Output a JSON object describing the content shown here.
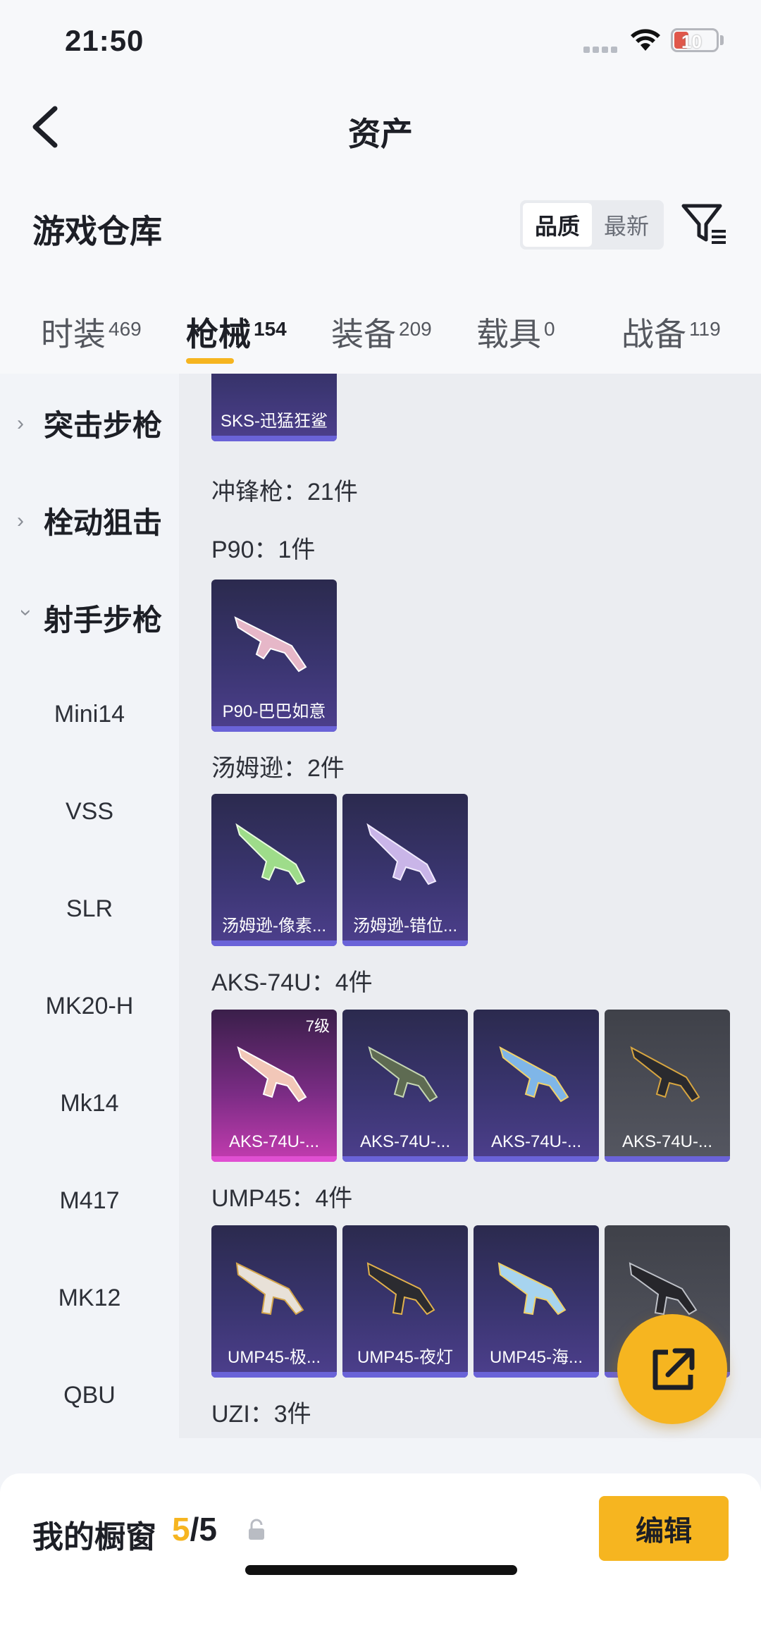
{
  "status_bar": {
    "time": "21:50",
    "battery": "10"
  },
  "header": {
    "title": "资产"
  },
  "warehouse": {
    "title": "游戏仓库",
    "sort_options": [
      {
        "label": "品质",
        "active": true
      },
      {
        "label": "最新",
        "active": false
      }
    ]
  },
  "tabs": [
    {
      "label": "时装",
      "count": "469",
      "active": false
    },
    {
      "label": "枪械",
      "count": "154",
      "active": true
    },
    {
      "label": "装备",
      "count": "209",
      "active": false
    },
    {
      "label": "载具",
      "count": "0",
      "active": false
    },
    {
      "label": "战备",
      "count": "119",
      "active": false
    }
  ],
  "sidebar": {
    "categories": [
      {
        "label": "突击步枪",
        "expanded": false
      },
      {
        "label": "栓动狙击",
        "expanded": false
      },
      {
        "label": "射手步枪",
        "expanded": true
      }
    ],
    "sub_items": [
      "Mini14",
      "VSS",
      "SLR",
      "MK20-H",
      "Mk14",
      "M417",
      "MK12",
      "QBU"
    ]
  },
  "content": {
    "top_card": "SKS-迅猛狂鲨",
    "groups": [
      {
        "label": "冲锋枪：21件"
      },
      {
        "label": "P90：1件",
        "cards": [
          {
            "name": "P90-巴巴如意",
            "style": "purple"
          }
        ]
      },
      {
        "label": "汤姆逊：2件",
        "cards": [
          {
            "name": "汤姆逊-像素...",
            "style": "purple"
          },
          {
            "name": "汤姆逊-错位...",
            "style": "purple"
          }
        ]
      },
      {
        "label": "AKS-74U：4件",
        "cards": [
          {
            "name": "AKS-74U-...",
            "style": "pink",
            "level": "7级"
          },
          {
            "name": "AKS-74U-...",
            "style": "purple"
          },
          {
            "name": "AKS-74U-...",
            "style": "purple"
          },
          {
            "name": "AKS-74U-...",
            "style": "gray"
          }
        ]
      },
      {
        "label": "UMP45：4件",
        "cards": [
          {
            "name": "UMP45-极...",
            "style": "purple"
          },
          {
            "name": "UMP45-夜灯",
            "style": "purple"
          },
          {
            "name": "UMP45-海...",
            "style": "purple"
          },
          {
            "name": "",
            "style": "gray"
          }
        ]
      },
      {
        "label": "UZI：3件"
      }
    ]
  },
  "showcase": {
    "label": "我的橱窗",
    "used": "5",
    "separator": "/",
    "total": "5"
  },
  "edit_button": "编辑",
  "colors": {
    "accent": "#f6b520",
    "card_purple": "#3a3570",
    "card_pink": "#c43cb0",
    "card_gray": "#4c4e57"
  },
  "icons": [
    "back-arrow-icon",
    "wifi-icon",
    "battery-icon",
    "filter-icon",
    "share-icon",
    "lock-icon"
  ]
}
